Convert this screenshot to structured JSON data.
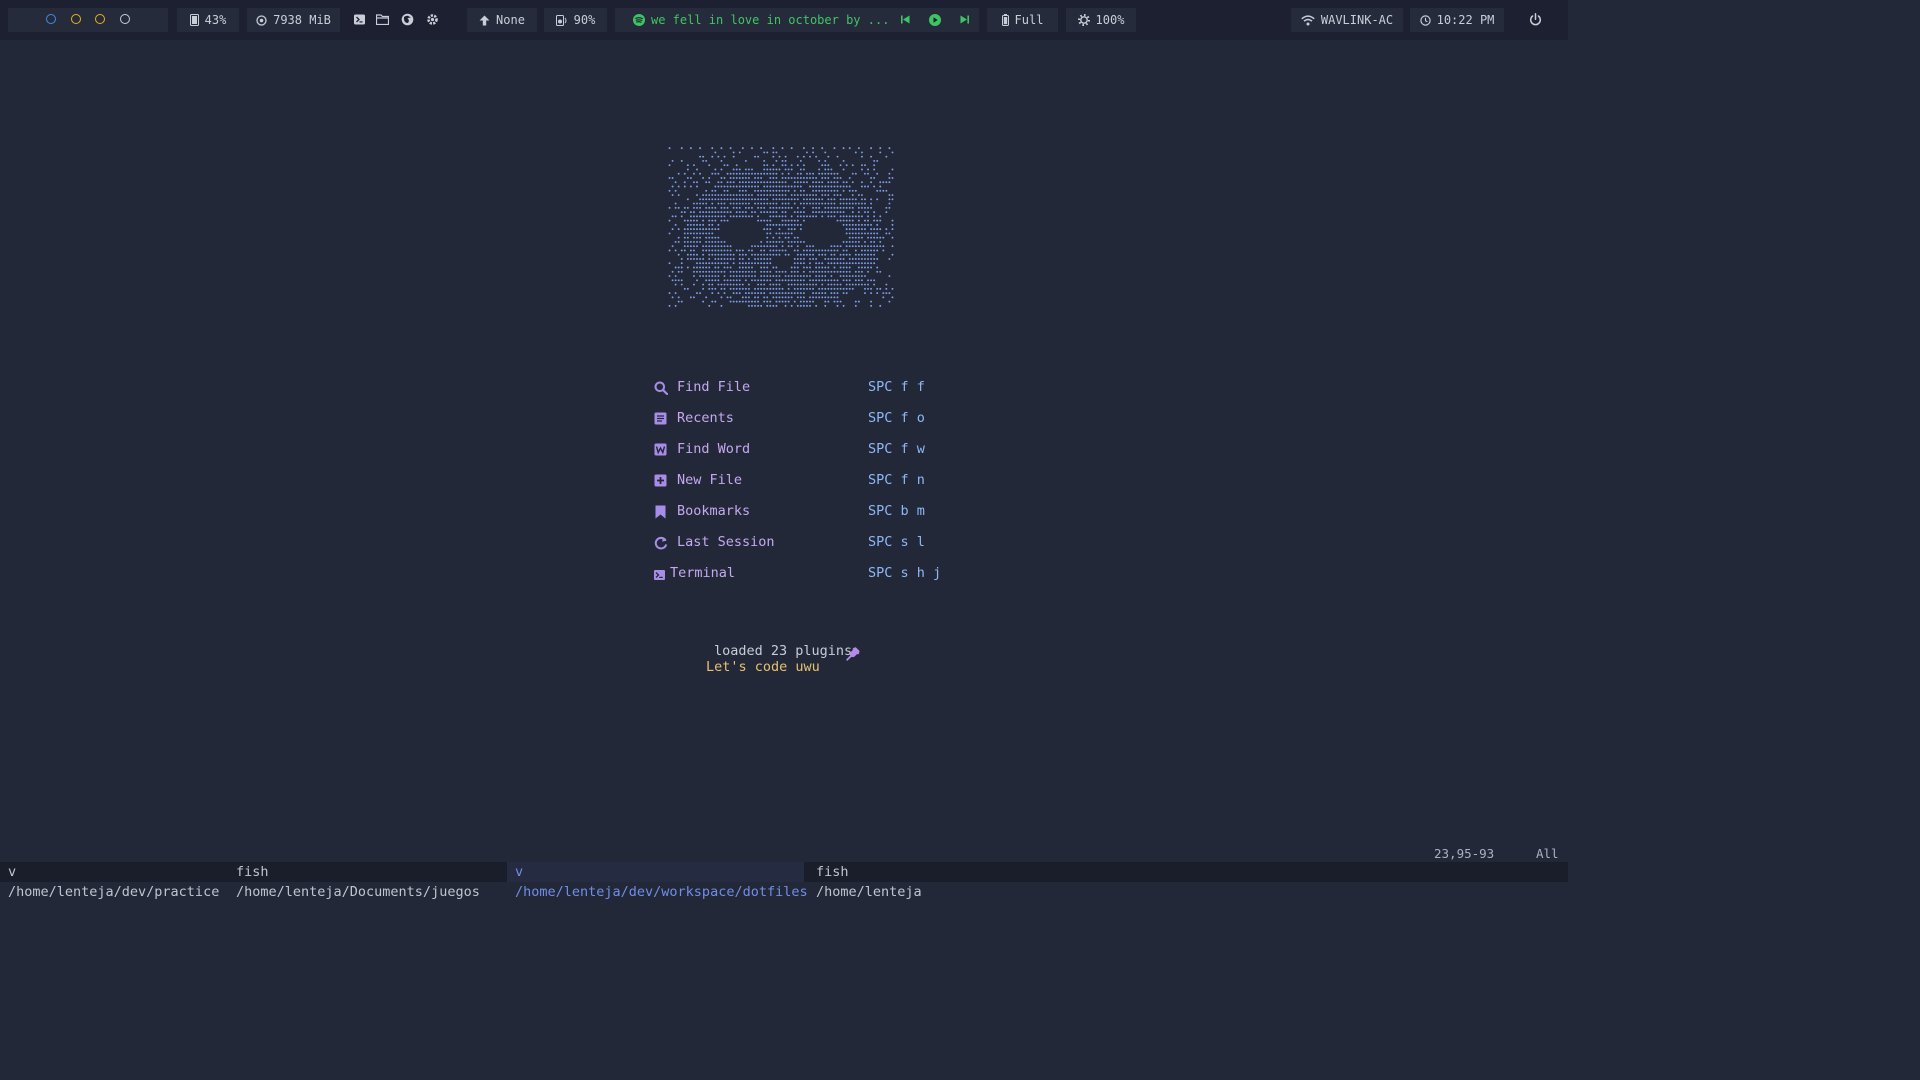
{
  "topbar": {
    "workspaces": [
      {
        "color": "#3d8fe0"
      },
      {
        "color": "#e8b020"
      },
      {
        "color": "#e8b020"
      },
      {
        "color": "#c8ccd6"
      }
    ],
    "storage": {
      "icon": "storage-icon",
      "value": "43%"
    },
    "memory": {
      "icon": "memory-icon",
      "value": "7938 MiB"
    },
    "launchers": [
      "terminal-icon",
      "folder-icon",
      "firefox-icon",
      "settings-icon"
    ],
    "network_speed": {
      "icon": "upload-arrow-icon",
      "value": "None"
    },
    "volume": {
      "icon": "speaker-icon",
      "value": "90%"
    },
    "media": {
      "icon": "spotify-icon",
      "title": "we fell in love in october by ...",
      "accent": "#40c463"
    },
    "battery": {
      "icon": "battery-icon",
      "value": "Full"
    },
    "brightness": {
      "icon": "brightness-icon",
      "value": "100%"
    },
    "wifi": {
      "icon": "wifi-icon",
      "value": "WAVLINK-AC"
    },
    "clock": {
      "icon": "clock-icon",
      "value": "10:22 PM"
    },
    "power": {
      "icon": "power-icon"
    }
  },
  "dashboard": {
    "menu": [
      {
        "icon": "search-icon",
        "label": "Find File",
        "key": "SPC f f"
      },
      {
        "icon": "document-icon",
        "label": "Recents",
        "key": "SPC f o"
      },
      {
        "icon": "word-icon",
        "label": "Find Word",
        "key": "SPC f w"
      },
      {
        "icon": "plus-square-icon",
        "label": "New File",
        "key": "SPC f n"
      },
      {
        "icon": "bookmark-icon",
        "label": "Bookmarks",
        "key": "SPC b m"
      },
      {
        "icon": "refresh-icon",
        "label": "Last Session",
        "key": "SPC s l"
      },
      {
        "icon": "terminal-icon",
        "label": "Terminal",
        "key": "SPC s h j"
      }
    ],
    "footer": {
      "plugins": "loaded 23 plugins",
      "plugins_icon": "plug-icon",
      "tagline": "Let's code uwu"
    },
    "colors": {
      "menu_label": "#c5a8f0",
      "menu_key": "#8cb8f8",
      "tagline": "#e8c070"
    }
  },
  "statusline": {
    "position": "23,95-93",
    "scroll": "All"
  },
  "tabline": {
    "tabs": [
      {
        "label": "v /home/lenteja/dev/practice",
        "active": false
      },
      {
        "label": "fish /home/lenteja/Documents/juegos",
        "active": false
      },
      {
        "label": "v /home/lenteja/dev/workspace/dotfiles",
        "active": true
      },
      {
        "label": "fish /home/lenteja",
        "active": false
      }
    ]
  }
}
